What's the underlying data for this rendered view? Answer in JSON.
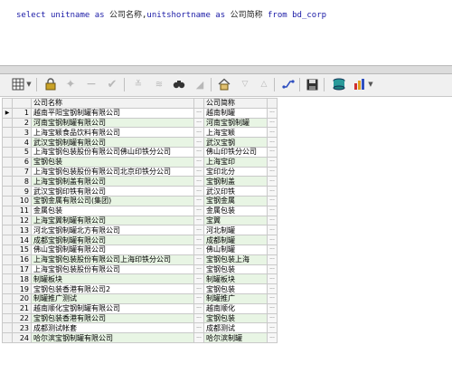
{
  "sql": {
    "kw_select": "select",
    "col1": "unitname",
    "kw_as1": "as",
    "alias1": "公司名称",
    "comma": ",",
    "col2": "unitshortname",
    "kw_as2": "as",
    "alias2": "公司简称",
    "kw_from": "from",
    "table": "bd_corp"
  },
  "toolbar": {
    "icons": [
      "grid-view-icon",
      "dropdown-arrow-icon",
      "lock-icon",
      "add-row-icon",
      "delete-row-icon",
      "post-icon",
      "filter-icon",
      "filter-clear-icon",
      "find-icon",
      "eraser-icon",
      "home-icon",
      "move-down-icon",
      "move-up-icon",
      "link-icon",
      "save-icon",
      "database-icon",
      "chart-icon"
    ]
  },
  "grid": {
    "headers": [
      "公司名称",
      "公司简称"
    ],
    "ellipsis": "···",
    "current_marker": "▶",
    "rows": [
      {
        "n": "1",
        "name": "越南平阳宝钢制罐有限公司",
        "short": "越南制罐"
      },
      {
        "n": "2",
        "name": "河南宝钢制罐有限公司",
        "short": "河南宝钢制罐"
      },
      {
        "n": "3",
        "name": "上海宝颖食品饮料有限公司",
        "short": "上海宝颖"
      },
      {
        "n": "4",
        "name": "武汉宝钢制罐有限公司",
        "short": "武汉宝钢"
      },
      {
        "n": "5",
        "name": "上海宝钢包装股份有限公司佛山印铁分公司",
        "short": "佛山印铁分公司"
      },
      {
        "n": "6",
        "name": "宝钢包装",
        "short": "上海宝印"
      },
      {
        "n": "7",
        "name": "上海宝钢包装股份有限公司北京印铁分公司",
        "short": "宝印北分"
      },
      {
        "n": "8",
        "name": "上海宝钢制盖有限公司",
        "short": "宝钢制盖"
      },
      {
        "n": "9",
        "name": "武汉宝钢印铁有限公司",
        "short": "武汉印铁"
      },
      {
        "n": "10",
        "name": "宝钢金属有限公司(集团)",
        "short": "宝钢金属"
      },
      {
        "n": "11",
        "name": "金属包装",
        "short": "金属包装"
      },
      {
        "n": "12",
        "name": "上海宝翼制罐有限公司",
        "short": "宝翼"
      },
      {
        "n": "13",
        "name": "河北宝钢制罐北方有限公司",
        "short": "河北制罐"
      },
      {
        "n": "14",
        "name": "成都宝钢制罐有限公司",
        "short": "成都制罐"
      },
      {
        "n": "15",
        "name": "佛山宝钢制罐有限公司",
        "short": "佛山制罐"
      },
      {
        "n": "16",
        "name": "上海宝钢包装股份有限公司上海印铁分公司",
        "short": "宝钢包装上海"
      },
      {
        "n": "17",
        "name": "上海宝钢包装股份有限公司",
        "short": "宝钢包装"
      },
      {
        "n": "18",
        "name": "制罐板块",
        "short": "制罐板块"
      },
      {
        "n": "19",
        "name": "宝钢包装香港有限公司2",
        "short": "宝钢包装"
      },
      {
        "n": "20",
        "name": "制罐推广测试",
        "short": "制罐推广"
      },
      {
        "n": "21",
        "name": "越南顺化宝钢制罐有限公司",
        "short": "越南顺化"
      },
      {
        "n": "22",
        "name": "宝钢包装香港有限公司",
        "short": "宝钢包装"
      },
      {
        "n": "23",
        "name": "成都测试帐套",
        "short": "成都测试"
      },
      {
        "n": "24",
        "name": "哈尔滨宝钢制罐有限公司",
        "short": "哈尔滨制罐"
      }
    ]
  }
}
